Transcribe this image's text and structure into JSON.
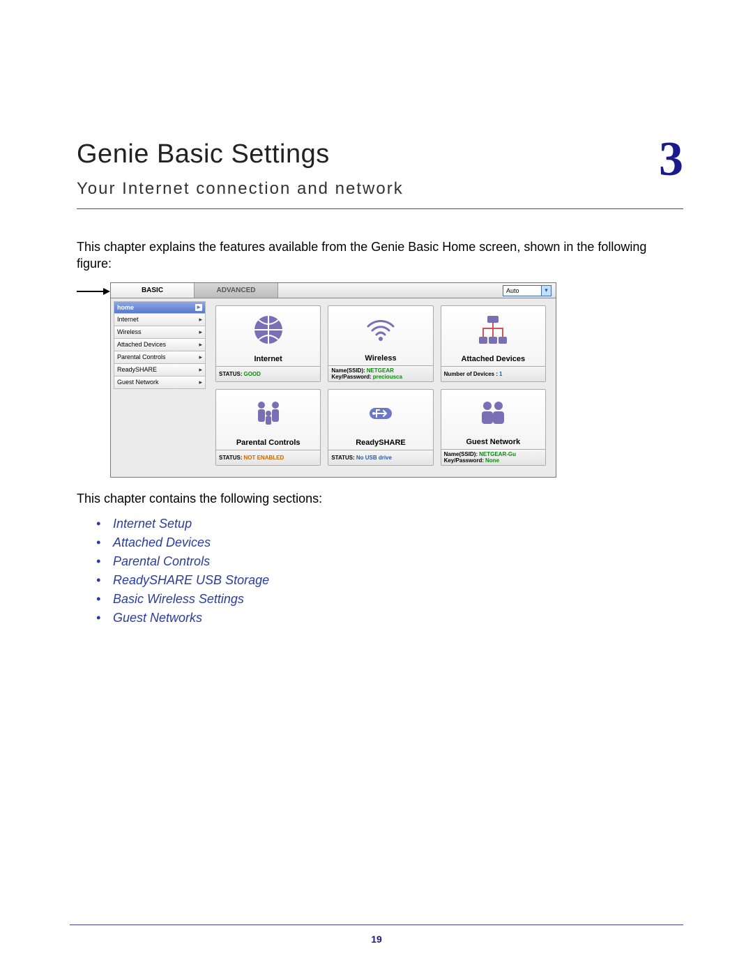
{
  "chapter": {
    "title": "Genie Basic Settings",
    "number": "3",
    "subtitle": "Your Internet connection and network"
  },
  "intro": "This chapter explains the features available from the Genie Basic Home screen, shown in the following figure:",
  "screenshot": {
    "tabs": {
      "basic": "BASIC",
      "advanced": "ADVANCED"
    },
    "language_selected": "Auto",
    "sidebar": {
      "home": "home",
      "items": [
        "Internet",
        "Wireless",
        "Attached Devices",
        "Parental Controls",
        "ReadySHARE",
        "Guest Network"
      ]
    },
    "tiles": {
      "internet": {
        "title": "Internet",
        "status_label": "STATUS:",
        "status_value": "GOOD"
      },
      "wireless": {
        "title": "Wireless",
        "line1_label": "Name(SSID):",
        "line1_value": "NETGEAR",
        "line2_label": "Key/Password:",
        "line2_value": "preciousca"
      },
      "attached": {
        "title": "Attached Devices",
        "line1_label": "Number of Devices :",
        "line1_value": "1"
      },
      "parental": {
        "title": "Parental Controls",
        "status_label": "STATUS:",
        "status_value": "NOT ENABLED"
      },
      "readyshare": {
        "title": "ReadySHARE",
        "status_label": "STATUS:",
        "status_value": "No USB drive"
      },
      "guest": {
        "title": "Guest Network",
        "line1_label": "Name(SSID):",
        "line1_value": "NETGEAR-Gu",
        "line2_label": "Key/Password:",
        "line2_value": "None"
      }
    }
  },
  "sections_intro": "This chapter contains the following sections:",
  "sections": [
    "Internet Setup",
    "Attached Devices",
    "Parental Controls",
    "ReadySHARE USB Storage",
    "Basic Wireless Settings",
    "Guest Networks"
  ],
  "page_number": "19"
}
